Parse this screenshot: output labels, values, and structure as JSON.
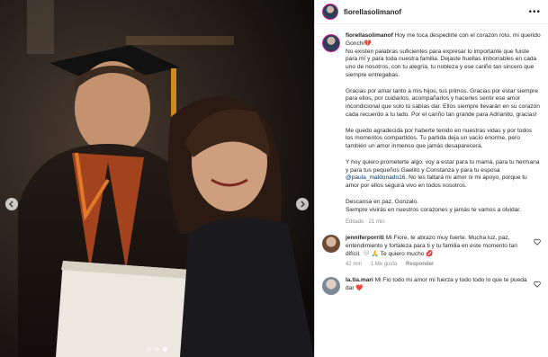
{
  "post": {
    "username": "fiorellasolimanof",
    "more_icon": "more-horizontal-icon",
    "caption": {
      "username": "fiorellasolimanof",
      "p1": "Hoy me toca despedirte con el corazón roto, mi querido Gonchi💔.",
      "p2": "No existen palabras suficientes para expresar lo importante que fuiste para mí y para toda nuestra familia. Dejaste huellas imborrables en cada uno de nosotros, con tu alegría, tu nobleza y ese cariño tan sincero que siempre entregabas.",
      "p3": "Gracias por amar tanto a mis hijos, tus primos. Gracias por estar siempre para ellos, por cuidarlos, acompañarlos y hacerles sentir ese amor incondicional que solo tú sabías dar. Ellos siempre llevarán en su corazón cada recuerdo a tu lado. Por el cariño tan grande para Adrianito, gracias!",
      "p4": "Me quedo agradecida por haberte tenido en nuestras vidas y por todos los momentos compartidos. Tu partida deja un vacío enorme, pero también un amor inmenso que jamás desaparecerá.",
      "p5a": "Y hoy quiero prometerte algo: voy a estar para tu mamá, para tu hermana y para tus pequeños Gaelito y Constanza y para tu esposa ",
      "p5_link": "@paula_maldonado16",
      "p5b": ". No les faltará mi amor ni mi apoyo, porque tu amor por ellos seguirá vivo en todos nosotros.",
      "p6a": "Descansa en paz, Gonzalo.",
      "p6b": "Siempre vivirás en nuestros corazones y jamás te vamos a olvidar.",
      "meta": "Editado · 21 min"
    },
    "comments": [
      {
        "username": "jenniferporriti",
        "text": "Mi Fiore, te abrazo muy fuerte. Mucha luz, paz, entendimiento y fortaleza para ti y tu familia en este momento tan difícil. 🤍 🙏 Te quiero mucho 💋",
        "time": "42 min",
        "likes": "1 Me gusta",
        "reply": "Responder"
      },
      {
        "username": "la.tia.mari",
        "text": "Mi Fio todo mi amor mi fuerza y todo todo lo que te pueda dar ❤️",
        "time": "",
        "likes": "",
        "reply": ""
      }
    ]
  },
  "carousel": {
    "prev_icon": "chevron-left-icon",
    "next_icon": "chevron-right-icon",
    "slides": 3,
    "active_slide": 2
  }
}
